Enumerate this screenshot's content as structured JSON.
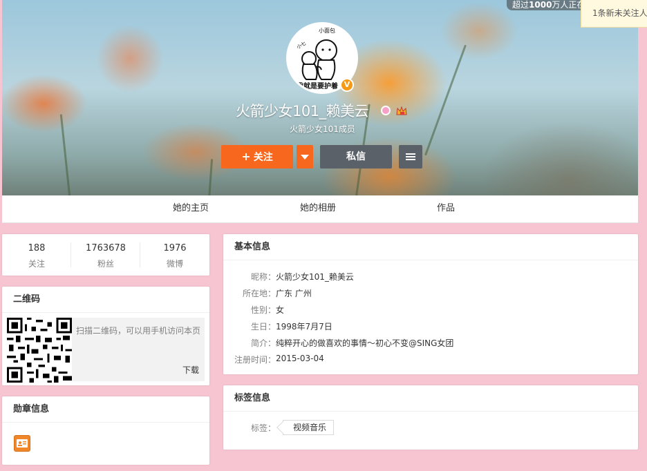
{
  "topbar": {
    "pill_prefix": "超过",
    "pill_bold": "1000",
    "pill_suffix": "万人正在",
    "notice": "1条新未关注人"
  },
  "profile": {
    "avatar_top": "小面包",
    "avatar_side": "小七",
    "avatar_caption": "我就是要护着",
    "verified_mark": "V",
    "nickname": "火箭少女101_赖美云",
    "subtitle": "火箭少女101成员"
  },
  "actions": {
    "follow": "关注",
    "message": "私信"
  },
  "tabs": [
    "她的主页",
    "她的相册",
    "作品"
  ],
  "stats": [
    {
      "num": "188",
      "label": "关注"
    },
    {
      "num": "1763678",
      "label": "粉丝"
    },
    {
      "num": "1976",
      "label": "微博"
    }
  ],
  "qrcode": {
    "title": "二维码",
    "hint": "扫描二维码，可以用手机访问本页",
    "download": "下载"
  },
  "medals": {
    "title": "勋章信息"
  },
  "basic_info": {
    "title": "基本信息",
    "rows": [
      {
        "key": "昵称：",
        "value": "火箭少女101_赖美云"
      },
      {
        "key": "所在地：",
        "value": "广东 广州"
      },
      {
        "key": "性别：",
        "value": "女"
      },
      {
        "key": "生日：",
        "value": "1998年7月7日"
      },
      {
        "key": "简介：",
        "value": "纯粹开心的做喜欢的事情～初心不变@SING女团"
      },
      {
        "key": "注册时间：",
        "value": "2015-03-04"
      }
    ]
  },
  "tag_info": {
    "title": "标签信息",
    "label": "标签：",
    "tags": [
      "视频音乐"
    ]
  },
  "colors": {
    "page_bg": "#f6c5d1",
    "follow_orange": "#f7671d",
    "dark_button": "#5b6169",
    "verified_orange": "#f59a14"
  }
}
